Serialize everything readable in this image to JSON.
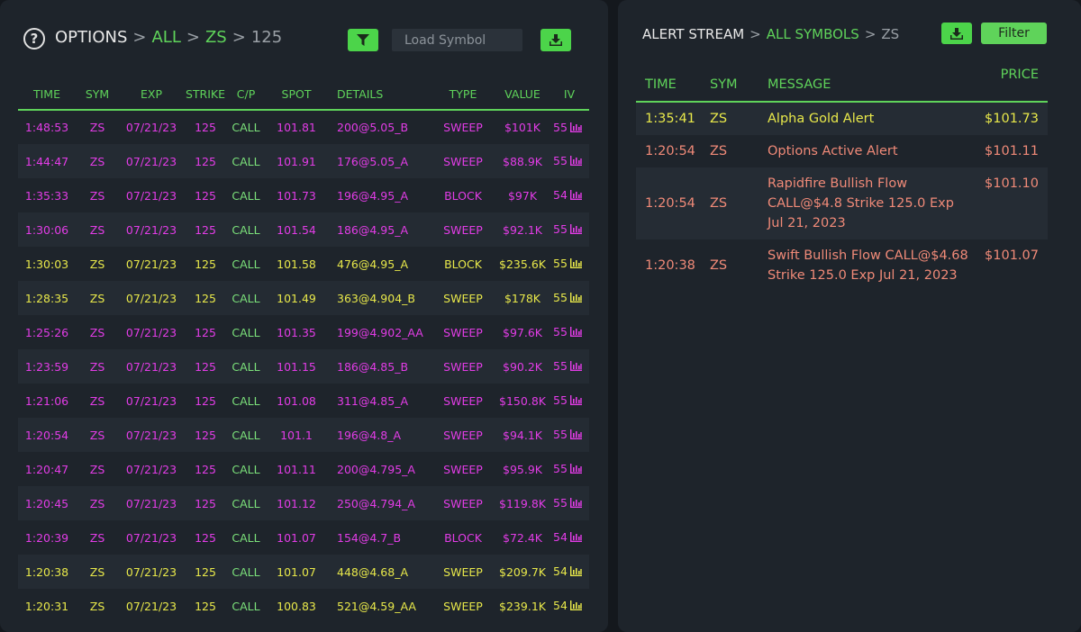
{
  "options_panel": {
    "breadcrumb": {
      "root": "OPTIONS",
      "sep": ">",
      "all": "ALL",
      "symbol": "ZS",
      "strike": "125"
    },
    "search_placeholder": "Load Symbol",
    "columns": [
      "TIME",
      "SYM",
      "EXP",
      "STRIKE",
      "C/P",
      "SPOT",
      "DETAILS",
      "TYPE",
      "VALUE",
      "IV"
    ],
    "colors": {
      "magenta": "#e23ce6",
      "yellow": "#e8e84a",
      "green": "#5fd35a"
    },
    "rows": [
      {
        "time": "1:48:53",
        "sym": "ZS",
        "exp": "07/21/23",
        "strike": "125",
        "cp": "CALL",
        "spot": "101.81",
        "details": "200@5.05_B",
        "type": "SWEEP",
        "value": "$101K",
        "iv": "55",
        "color": "magenta"
      },
      {
        "time": "1:44:47",
        "sym": "ZS",
        "exp": "07/21/23",
        "strike": "125",
        "cp": "CALL",
        "spot": "101.91",
        "details": "176@5.05_A",
        "type": "SWEEP",
        "value": "$88.9K",
        "iv": "55",
        "color": "magenta"
      },
      {
        "time": "1:35:33",
        "sym": "ZS",
        "exp": "07/21/23",
        "strike": "125",
        "cp": "CALL",
        "spot": "101.73",
        "details": "196@4.95_A",
        "type": "BLOCK",
        "value": "$97K",
        "iv": "54",
        "color": "magenta"
      },
      {
        "time": "1:30:06",
        "sym": "ZS",
        "exp": "07/21/23",
        "strike": "125",
        "cp": "CALL",
        "spot": "101.54",
        "details": "186@4.95_A",
        "type": "SWEEP",
        "value": "$92.1K",
        "iv": "55",
        "color": "magenta"
      },
      {
        "time": "1:30:03",
        "sym": "ZS",
        "exp": "07/21/23",
        "strike": "125",
        "cp": "CALL",
        "spot": "101.58",
        "details": "476@4.95_A",
        "type": "BLOCK",
        "value": "$235.6K",
        "iv": "55",
        "color": "yellow"
      },
      {
        "time": "1:28:35",
        "sym": "ZS",
        "exp": "07/21/23",
        "strike": "125",
        "cp": "CALL",
        "spot": "101.49",
        "details": "363@4.904_B",
        "type": "SWEEP",
        "value": "$178K",
        "iv": "55",
        "color": "yellow"
      },
      {
        "time": "1:25:26",
        "sym": "ZS",
        "exp": "07/21/23",
        "strike": "125",
        "cp": "CALL",
        "spot": "101.35",
        "details": "199@4.902_AA",
        "type": "SWEEP",
        "value": "$97.6K",
        "iv": "55",
        "color": "magenta"
      },
      {
        "time": "1:23:59",
        "sym": "ZS",
        "exp": "07/21/23",
        "strike": "125",
        "cp": "CALL",
        "spot": "101.15",
        "details": "186@4.85_B",
        "type": "SWEEP",
        "value": "$90.2K",
        "iv": "55",
        "color": "magenta"
      },
      {
        "time": "1:21:06",
        "sym": "ZS",
        "exp": "07/21/23",
        "strike": "125",
        "cp": "CALL",
        "spot": "101.08",
        "details": "311@4.85_A",
        "type": "SWEEP",
        "value": "$150.8K",
        "iv": "55",
        "color": "magenta"
      },
      {
        "time": "1:20:54",
        "sym": "ZS",
        "exp": "07/21/23",
        "strike": "125",
        "cp": "CALL",
        "spot": "101.1",
        "details": "196@4.8_A",
        "type": "SWEEP",
        "value": "$94.1K",
        "iv": "55",
        "color": "magenta"
      },
      {
        "time": "1:20:47",
        "sym": "ZS",
        "exp": "07/21/23",
        "strike": "125",
        "cp": "CALL",
        "spot": "101.11",
        "details": "200@4.795_A",
        "type": "SWEEP",
        "value": "$95.9K",
        "iv": "55",
        "color": "magenta"
      },
      {
        "time": "1:20:45",
        "sym": "ZS",
        "exp": "07/21/23",
        "strike": "125",
        "cp": "CALL",
        "spot": "101.12",
        "details": "250@4.794_A",
        "type": "SWEEP",
        "value": "$119.8K",
        "iv": "55",
        "color": "magenta"
      },
      {
        "time": "1:20:39",
        "sym": "ZS",
        "exp": "07/21/23",
        "strike": "125",
        "cp": "CALL",
        "spot": "101.07",
        "details": "154@4.7_B",
        "type": "BLOCK",
        "value": "$72.4K",
        "iv": "54",
        "color": "magenta"
      },
      {
        "time": "1:20:38",
        "sym": "ZS",
        "exp": "07/21/23",
        "strike": "125",
        "cp": "CALL",
        "spot": "101.07",
        "details": "448@4.68_A",
        "type": "SWEEP",
        "value": "$209.7K",
        "iv": "54",
        "color": "yellow"
      },
      {
        "time": "1:20:31",
        "sym": "ZS",
        "exp": "07/21/23",
        "strike": "125",
        "cp": "CALL",
        "spot": "100.83",
        "details": "521@4.59_AA",
        "type": "SWEEP",
        "value": "$239.1K",
        "iv": "54",
        "color": "yellow"
      }
    ]
  },
  "alert_panel": {
    "breadcrumb": {
      "root": "ALERT STREAM",
      "sep": ">",
      "all": "ALL SYMBOLS",
      "symbol": "ZS"
    },
    "filter_label": "Filter",
    "columns": {
      "time": "TIME",
      "sym": "SYM",
      "message": "MESSAGE",
      "price": "PRICE"
    },
    "colors": {
      "yellow": "#e8e84a",
      "salmon": "#f08a78"
    },
    "alerts": [
      {
        "time": "1:35:41",
        "sym": "ZS",
        "message": "Alpha Gold Alert",
        "price": "$101.73",
        "color": "yellow"
      },
      {
        "time": "1:20:54",
        "sym": "ZS",
        "message": "Options Active Alert",
        "price": "$101.11",
        "color": "salmon"
      },
      {
        "time": "1:20:54",
        "sym": "ZS",
        "message": "Rapidfire Bullish Flow CALL@$4.8 Strike 125.0 Exp Jul 21, 2023",
        "price": "$101.10",
        "color": "salmon"
      },
      {
        "time": "1:20:38",
        "sym": "ZS",
        "message": "Swift Bullish Flow CALL@$4.68 Strike 125.0 Exp Jul 21, 2023",
        "price": "$101.07",
        "color": "salmon"
      }
    ]
  }
}
